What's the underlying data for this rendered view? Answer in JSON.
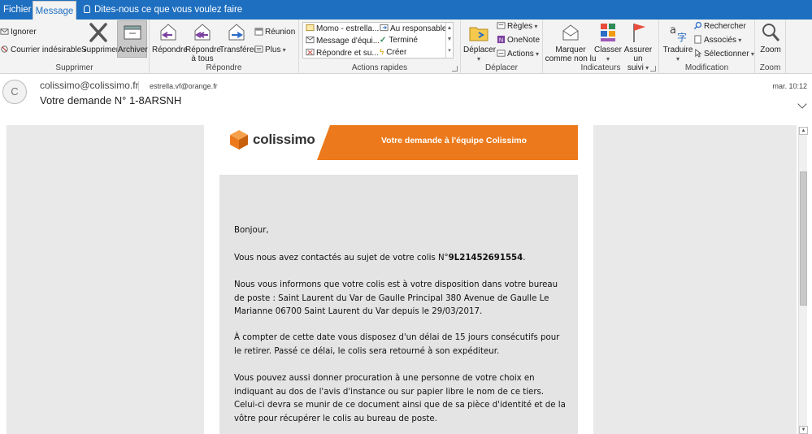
{
  "tabs": {
    "file": "Fichier",
    "message": "Message",
    "tell_me": "Dites-nous ce que vous voulez faire"
  },
  "ribbon": {
    "delete_group": {
      "ignore": "Ignorer",
      "junk": "Courrier indésirable",
      "delete": "Supprimer",
      "archive": "Archiver",
      "label": "Supprimer"
    },
    "respond_group": {
      "reply": "Répondre",
      "reply_all_line1": "Répondre",
      "reply_all_line2": "à tous",
      "forward": "Transférer",
      "meeting": "Réunion",
      "more": "Plus",
      "label": "Répondre"
    },
    "quick_steps": {
      "items": [
        "Momo - estrella...",
        "Message d'équi...",
        "Répondre et su...",
        "Au responsable",
        "Terminé",
        "Créer"
      ],
      "label": "Actions rapides"
    },
    "move_group": {
      "move": "Déplacer",
      "rules": "Règles",
      "onenote": "OneNote",
      "actions": "Actions",
      "label": "Déplacer"
    },
    "tags_group": {
      "mark_line1": "Marquer",
      "mark_line2": "comme non lu",
      "categorize": "Classer",
      "followup_line1": "Assurer un",
      "followup_line2": "suivi",
      "label": "Indicateurs"
    },
    "editing_group": {
      "translate": "Traduire",
      "find": "Rechercher",
      "related": "Associés",
      "select": "Sélectionner",
      "label": "Modification"
    },
    "zoom_group": {
      "zoom": "Zoom",
      "label": "Zoom"
    }
  },
  "message": {
    "avatar_initial": "C",
    "from": "colissimo@colissimo.fr",
    "to": "estrella.vf@orange.fr",
    "subject": "Votre demande N° 1-8ARSNH",
    "date": "mar. 10:12"
  },
  "email": {
    "logo_text": "colissimo",
    "banner": "Votre demande à l'équipe Colissimo",
    "greeting": "Bonjour,",
    "p1_prefix": "Vous nous avez contactés au sujet de votre colis N°",
    "p1_tracking": "9L21452691554",
    "p1_suffix": ".",
    "p2": "Nous vous informons que votre colis est à votre disposition dans votre bureau de poste : Saint Laurent du Var de Gaulle Principal 380 Avenue de Gaulle Le Marianne 06700 Saint Laurent du Var depuis le 29/03/2017.",
    "p3": "À compter de cette date vous disposez d'un délai de 15 jours consécutifs pour le retirer. Passé ce délai, le colis sera retourné à son expéditeur.",
    "p4": "Vous pouvez aussi donner procuration à une personne de votre choix en indiquant au dos de l'avis d'instance ou sur papier libre le nom de ce tiers. Celui-ci devra se munir de ce document ainsi que de sa pièce d'identité et de la vôtre pour récupérer le colis au bureau de poste."
  },
  "colors": {
    "titlebar": "#1e6fc0",
    "brand_orange": "#ec7a1c"
  },
  "icons": {
    "tell_me": "lightbulb-icon",
    "ignore": "ignore-icon",
    "junk": "junk-icon",
    "delete": "delete-x-icon",
    "archive": "archive-box-icon",
    "reply": "reply-icon",
    "reply_all": "reply-all-icon",
    "forward": "forward-icon",
    "move": "folder-move-icon",
    "mark_unread": "envelope-icon",
    "categorize": "color-grid-icon",
    "followup": "flag-icon",
    "translate": "translate-icon",
    "find": "search-icon",
    "zoom": "magnifier-icon"
  }
}
